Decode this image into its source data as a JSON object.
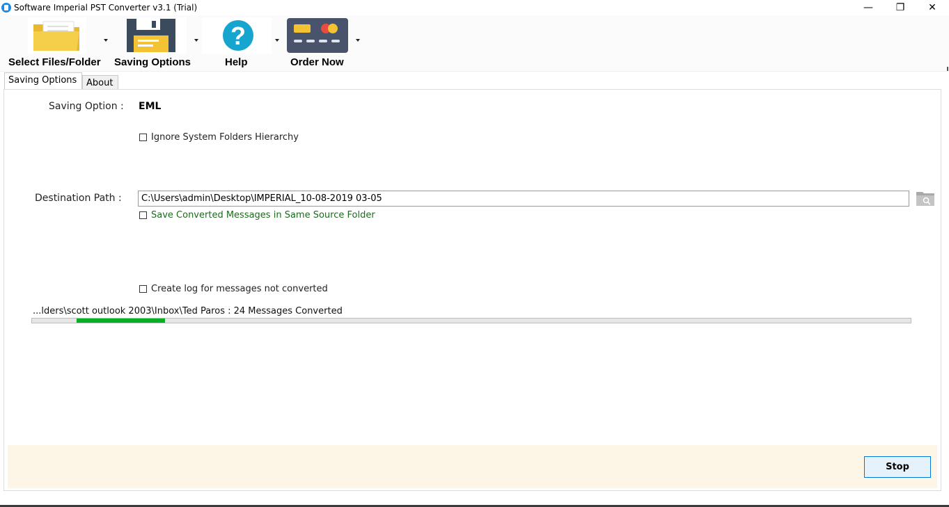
{
  "window": {
    "title": "Software Imperial PST Converter v3.1 (Trial)",
    "minimize_glyph": "—",
    "maximize_glyph": "❐",
    "close_glyph": "✕"
  },
  "toolbar": {
    "select_files_label": "Select Files/Folder",
    "saving_options_label": "Saving Options",
    "help_label": "Help",
    "order_now_label": "Order Now",
    "icons": [
      "folder-icon",
      "floppy-disk-icon",
      "help-icon",
      "credit-card-icon"
    ]
  },
  "tabs": [
    {
      "label": "Saving Options",
      "active": true
    },
    {
      "label": "About",
      "active": false
    }
  ],
  "saving": {
    "option_label": "Saving Option :",
    "option_value": "EML",
    "ignore_hierarchy_label": "Ignore System Folders Hierarchy",
    "ignore_hierarchy_checked": false,
    "destination_label": "Destination Path :",
    "destination_value": "C:\\Users\\admin\\Desktop\\IMPERIAL_10-08-2019 03-05",
    "same_folder_label": "Save Converted Messages in Same Source Folder",
    "same_folder_checked": false,
    "create_log_label": "Create log for messages not converted",
    "create_log_checked": false
  },
  "progress": {
    "status_text": "...lders\\scott outlook 2003\\Inbox\\Ted Paros : 24 Messages Converted",
    "fill_start_fraction": 0.051,
    "fill_end_fraction": 0.151
  },
  "footer": {
    "stop_label": "Stop"
  },
  "colors": {
    "progress_green": "#06b025",
    "footer_bg": "#fdf5e6",
    "same_folder_text": "#1b6b1b",
    "stop_border": "#0078d7"
  }
}
